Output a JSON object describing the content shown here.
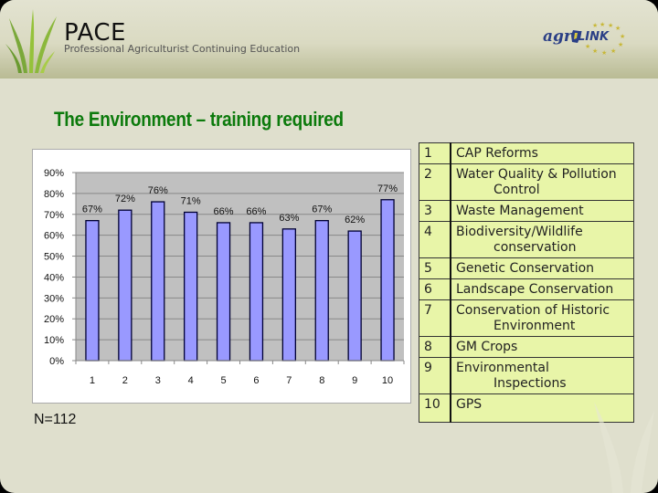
{
  "header": {
    "logo_title": "PACE",
    "logo_subtitle": "Professional Agriculturist Continuing Education",
    "partner_logo_text_1": "agr",
    "partner_logo_text_2": "LINK",
    "icons": [
      "grass-logo-icon",
      "agrilink-logo-icon",
      "eu-stars-icon"
    ]
  },
  "slide": {
    "title": "The Environment – training required",
    "sample_size": "N=112"
  },
  "chart_data": {
    "type": "bar",
    "title": "",
    "xlabel": "",
    "ylabel": "",
    "categories": [
      "1",
      "2",
      "3",
      "4",
      "5",
      "6",
      "7",
      "8",
      "9",
      "10"
    ],
    "values": [
      67,
      72,
      76,
      71,
      66,
      66,
      63,
      67,
      62,
      77
    ],
    "data_labels": [
      "67%",
      "72%",
      "76%",
      "71%",
      "66%",
      "66%",
      "63%",
      "67%",
      "62%",
      "77%"
    ],
    "ylim": [
      0,
      90
    ],
    "yticks": [
      "0%",
      "10%",
      "20%",
      "30%",
      "40%",
      "50%",
      "60%",
      "70%",
      "80%",
      "90%"
    ],
    "ytick_values": [
      0,
      10,
      20,
      30,
      40,
      50,
      60,
      70,
      80,
      90
    ],
    "grid": true,
    "legend": "none",
    "bar_color": "#9999ff",
    "plot_background": "#c0c0c0"
  },
  "legend_table": {
    "rows": [
      {
        "num": "1",
        "line1": "CAP Reforms",
        "line2": ""
      },
      {
        "num": "2",
        "line1": "Water Quality & Pollution",
        "line2": "Control"
      },
      {
        "num": "3",
        "line1": "Waste Management",
        "line2": ""
      },
      {
        "num": "4",
        "line1": "Biodiversity/Wildlife",
        "line2": "conservation"
      },
      {
        "num": "5",
        "line1": "Genetic Conservation",
        "line2": ""
      },
      {
        "num": "6",
        "line1": "Landscape Conservation",
        "line2": ""
      },
      {
        "num": "7",
        "line1": "Conservation of Historic",
        "line2": "Environment"
      },
      {
        "num": "8",
        "line1": "GM Crops",
        "line2": ""
      },
      {
        "num": "9",
        "line1": "Environmental",
        "line2": "Inspections"
      },
      {
        "num": "10",
        "line1": "GPS",
        "line2": ""
      }
    ]
  },
  "colors": {
    "title_green": "#0c7a0c",
    "table_fill": "#e8f5a8",
    "slide_bg": "#dfdfcd"
  }
}
